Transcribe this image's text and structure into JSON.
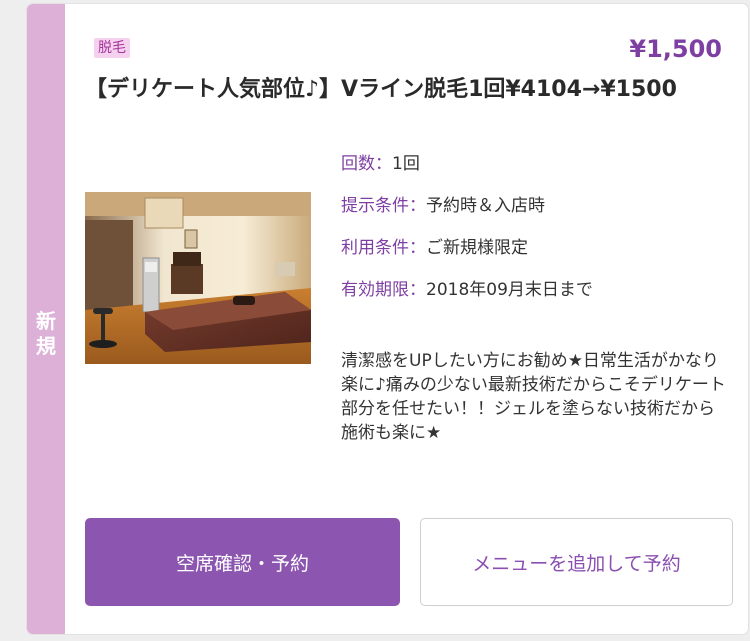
{
  "card": {
    "badge": "新規",
    "category": "脱毛",
    "price": "¥1,500",
    "title": "【デリケート人気部位♪】Vライン脱毛1回¥4104→¥1500",
    "photo_alt": "treatment room photo",
    "info": [
      {
        "key": "回数：",
        "value": "1回"
      },
      {
        "key": "提示条件：",
        "value": "予約時＆入店時"
      },
      {
        "key": "利用条件：",
        "value": "ご新規様限定"
      },
      {
        "key": "有効期限：",
        "value": "2018年09月末日まで"
      }
    ],
    "description": "清潔感をUPしたい方にお勧め★日常生活がかなり楽に♪痛みの少ない最新技術だからこそデリケート部分を任せたい！！ジェルを塗らない技術だから施術も楽に★",
    "buttons": {
      "reserve": "空席確認・予約",
      "add_menu": "メニューを追加して予約"
    }
  },
  "colors": {
    "accent": "#8c55b0",
    "side_stripe": "#ddb0d8",
    "tag_bg": "#f6d0ef",
    "price": "#7e3fa3"
  }
}
